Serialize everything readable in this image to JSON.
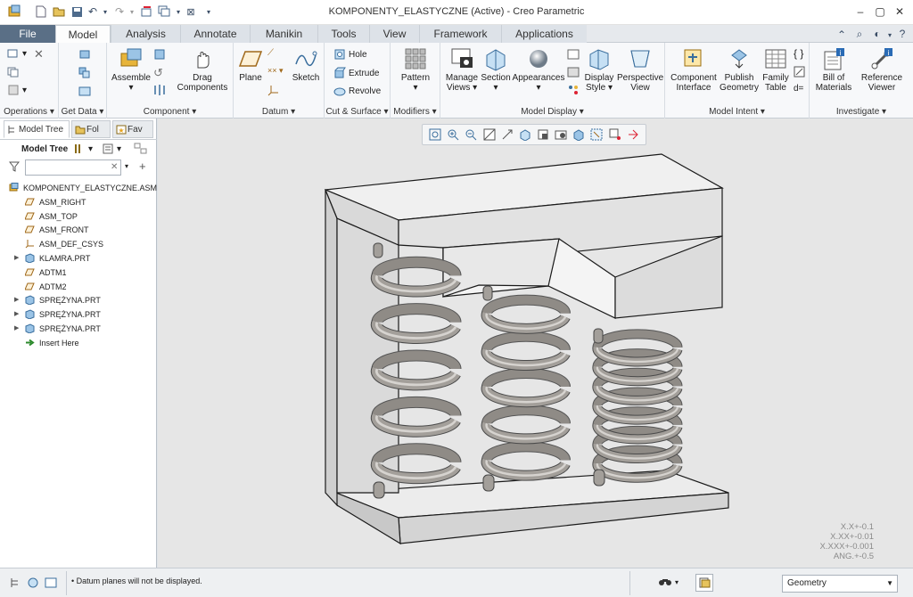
{
  "window": {
    "title": "KOMPONENTY_ELASTYCZNE (Active) - Creo Parametric"
  },
  "tabs": [
    "File",
    "Model",
    "Analysis",
    "Annotate",
    "Manikin",
    "Tools",
    "View",
    "Framework",
    "Applications"
  ],
  "active_tab": "Model",
  "ribbon": {
    "groups": {
      "operations": "Operations",
      "get_data": "Get Data",
      "component": "Component",
      "datum": "Datum",
      "cut_surface": "Cut & Surface",
      "modifiers": "Modifiers",
      "model_display": "Model Display",
      "model_intent": "Model Intent",
      "investigate": "Investigate"
    },
    "buttons": {
      "assemble": "Assemble",
      "drag_components_1": "Drag",
      "drag_components_2": "Components",
      "plane": "Plane",
      "sketch": "Sketch",
      "hole": "Hole",
      "extrude": "Extrude",
      "revolve": "Revolve",
      "pattern": "Pattern",
      "manage_views_1": "Manage",
      "manage_views_2": "Views",
      "section": "Section",
      "appearances": "Appearances",
      "display_style_1": "Display",
      "display_style_2": "Style",
      "perspective_view_1": "Perspective",
      "perspective_view_2": "View",
      "component_interface_1": "Component",
      "component_interface_2": "Interface",
      "publish_geometry_1": "Publish",
      "publish_geometry_2": "Geometry",
      "family_table_1": "Family",
      "family_table_2": "Table",
      "bill_of_materials_1": "Bill of",
      "bill_of_materials_2": "Materials",
      "reference_viewer_1": "Reference",
      "reference_viewer_2": "Viewer"
    }
  },
  "left_panel": {
    "tabs": [
      "Model Tree",
      "Fol",
      "Fav"
    ],
    "header": "Model Tree",
    "search_value": "",
    "tree": [
      {
        "label": "KOMPONENTY_ELASTYCZNE.ASM",
        "icon": "assembly-icon",
        "expandable": false,
        "indent": 0
      },
      {
        "label": "ASM_RIGHT",
        "icon": "datum-plane-icon",
        "expandable": false,
        "indent": 1
      },
      {
        "label": "ASM_TOP",
        "icon": "datum-plane-icon",
        "expandable": false,
        "indent": 1
      },
      {
        "label": "ASM_FRONT",
        "icon": "datum-plane-icon",
        "expandable": false,
        "indent": 1
      },
      {
        "label": "ASM_DEF_CSYS",
        "icon": "csys-icon",
        "expandable": false,
        "indent": 1
      },
      {
        "label": "KLAMRA.PRT",
        "icon": "part-icon",
        "expandable": true,
        "indent": 1
      },
      {
        "label": "ADTM1",
        "icon": "datum-plane-icon",
        "expandable": false,
        "indent": 1
      },
      {
        "label": "ADTM2",
        "icon": "datum-plane-icon",
        "expandable": false,
        "indent": 1
      },
      {
        "label": "SPRĘŻYNA.PRT",
        "icon": "part-icon",
        "expandable": true,
        "indent": 1
      },
      {
        "label": "SPRĘŻYNA.PRT",
        "icon": "part-icon",
        "expandable": true,
        "indent": 1
      },
      {
        "label": "SPRĘŻYNA.PRT",
        "icon": "part-icon",
        "expandable": true,
        "indent": 1
      },
      {
        "label": "Insert Here",
        "icon": "insert-arrow-icon",
        "expandable": false,
        "indent": 1
      }
    ]
  },
  "viewport": {
    "tolerances": [
      "X.X+-0.1",
      "X.XX+-0.01",
      "X.XXX+-0.001",
      "ANG.+-0.5"
    ]
  },
  "status": {
    "message": "Datum planes will not be displayed.",
    "filter_value": "Geometry"
  },
  "colors": {
    "file_tab": "#5a6f86",
    "viewport_bg": "#e6e6e6",
    "model_face": "#e3e3e3",
    "spring": "#a39f9a"
  }
}
